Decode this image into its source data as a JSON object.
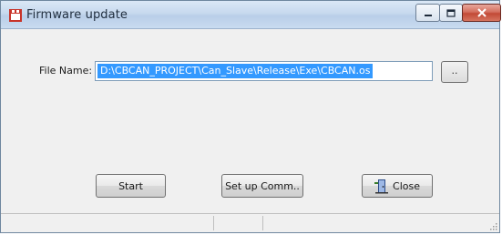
{
  "window": {
    "title": "Firmware update",
    "controls": {
      "minimize_icon": "minimize-icon",
      "maximize_icon": "maximize-icon",
      "close_icon": "close-icon"
    }
  },
  "form": {
    "file_label": "File Name:",
    "file_value": "D:\\CBCAN_PROJECT\\Can_Slave\\Release\\Exe\\CBCAN.os",
    "browse_label": ".."
  },
  "buttons": {
    "start": "Start",
    "setup": "Set up Comm..",
    "close": "Close",
    "close_icon": "exit-door-icon"
  },
  "colors": {
    "selection": "#3399ff",
    "titlebar": "#c7d9ee",
    "close_button": "#c24a36"
  }
}
